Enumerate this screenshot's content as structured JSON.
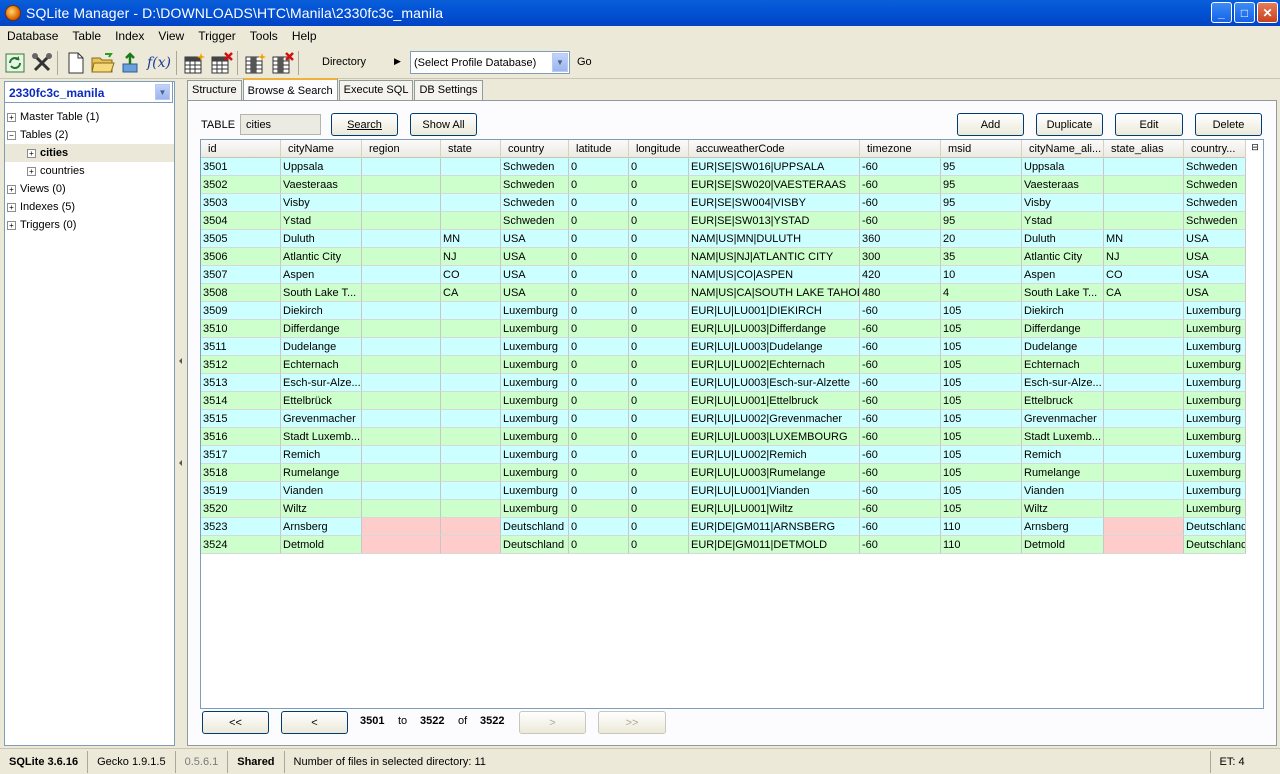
{
  "window": {
    "title": "SQLite Manager - D:\\DOWNLOADS\\HTC\\Manila\\2330fc3c_manila"
  },
  "menu": [
    "Database",
    "Table",
    "Index",
    "View",
    "Trigger",
    "Tools",
    "Help"
  ],
  "toolbar": {
    "directory_label": "Directory",
    "profile_select": "(Select Profile Database)",
    "go_label": "Go",
    "icons": [
      "refresh-icon",
      "tools-icon",
      "new-db-icon",
      "open-db-icon",
      "connect-db-icon",
      "function-icon",
      "create-table-icon",
      "drop-table-icon",
      "create-index-icon",
      "drop-index-icon"
    ],
    "function_glyph": "f(x)"
  },
  "sidebar": {
    "database": "2330fc3c_manila",
    "tree": [
      {
        "label": "Master Table (1)",
        "sign": "+",
        "level": 0,
        "bold": false
      },
      {
        "label": "Tables (2)",
        "sign": "−",
        "level": 0,
        "bold": false
      },
      {
        "label": "cities",
        "sign": "+",
        "level": 1,
        "bold": true
      },
      {
        "label": "countries",
        "sign": "+",
        "level": 1,
        "bold": false
      },
      {
        "label": "Views (0)",
        "sign": "+",
        "level": 0,
        "bold": false
      },
      {
        "label": "Indexes (5)",
        "sign": "+",
        "level": 0,
        "bold": false
      },
      {
        "label": "Triggers (0)",
        "sign": "+",
        "level": 0,
        "bold": false
      }
    ]
  },
  "tabs": [
    "Structure",
    "Browse & Search",
    "Execute SQL",
    "DB Settings"
  ],
  "active_tab": "Browse & Search",
  "browse": {
    "table_label": "TABLE",
    "table_value": "cities",
    "search_label": "Search",
    "showall_label": "Show All",
    "add_label": "Add",
    "duplicate_label": "Duplicate",
    "edit_label": "Edit",
    "delete_label": "Delete"
  },
  "grid": {
    "columns": [
      "id",
      "cityName",
      "region",
      "state",
      "country",
      "latitude",
      "longitude",
      "accuweatherCode",
      "timezone",
      "msid",
      "cityName_ali...",
      "state_alias",
      "country..."
    ],
    "rows": [
      [
        "3501",
        "Uppsala",
        "",
        "",
        "Schweden",
        "0",
        "0",
        "EUR|SE|SW016|UPPSALA",
        "-60",
        "95",
        "Uppsala",
        "",
        "Schweden"
      ],
      [
        "3502",
        "Vaesteraas",
        "",
        "",
        "Schweden",
        "0",
        "0",
        "EUR|SE|SW020|VAESTERAAS",
        "-60",
        "95",
        "Vaesteraas",
        "",
        "Schweden"
      ],
      [
        "3503",
        "Visby",
        "",
        "",
        "Schweden",
        "0",
        "0",
        "EUR|SE|SW004|VISBY",
        "-60",
        "95",
        "Visby",
        "",
        "Schweden"
      ],
      [
        "3504",
        "Ystad",
        "",
        "",
        "Schweden",
        "0",
        "0",
        "EUR|SE|SW013|YSTAD",
        "-60",
        "95",
        "Ystad",
        "",
        "Schweden"
      ],
      [
        "3505",
        "Duluth",
        "",
        "MN",
        "USA",
        "0",
        "0",
        "NAM|US|MN|DULUTH",
        "360",
        "20",
        "Duluth",
        "MN",
        "USA"
      ],
      [
        "3506",
        "Atlantic City",
        "",
        "NJ",
        "USA",
        "0",
        "0",
        "NAM|US|NJ|ATLANTIC CITY",
        "300",
        "35",
        "Atlantic City",
        "NJ",
        "USA"
      ],
      [
        "3507",
        "Aspen",
        "",
        "CO",
        "USA",
        "0",
        "0",
        "NAM|US|CO|ASPEN",
        "420",
        "10",
        "Aspen",
        "CO",
        "USA"
      ],
      [
        "3508",
        "South Lake T...",
        "",
        "CA",
        "USA",
        "0",
        "0",
        "NAM|US|CA|SOUTH LAKE TAHOE",
        "480",
        "4",
        "South Lake T...",
        "CA",
        "USA"
      ],
      [
        "3509",
        "Diekirch",
        "",
        "",
        "Luxemburg",
        "0",
        "0",
        "EUR|LU|LU001|DIEKIRCH",
        "-60",
        "105",
        "Diekirch",
        "",
        "Luxemburg"
      ],
      [
        "3510",
        "Differdange",
        "",
        "",
        "Luxemburg",
        "0",
        "0",
        "EUR|LU|LU003|Differdange",
        "-60",
        "105",
        "Differdange",
        "",
        "Luxemburg"
      ],
      [
        "3511",
        "Dudelange",
        "",
        "",
        "Luxemburg",
        "0",
        "0",
        "EUR|LU|LU003|Dudelange",
        "-60",
        "105",
        "Dudelange",
        "",
        "Luxemburg"
      ],
      [
        "3512",
        "Echternach",
        "",
        "",
        "Luxemburg",
        "0",
        "0",
        "EUR|LU|LU002|Echternach",
        "-60",
        "105",
        "Echternach",
        "",
        "Luxemburg"
      ],
      [
        "3513",
        "Esch-sur-Alze...",
        "",
        "",
        "Luxemburg",
        "0",
        "0",
        "EUR|LU|LU003|Esch-sur-Alzette",
        "-60",
        "105",
        "Esch-sur-Alze...",
        "",
        "Luxemburg"
      ],
      [
        "3514",
        "Ettelbrück",
        "",
        "",
        "Luxemburg",
        "0",
        "0",
        "EUR|LU|LU001|Ettelbruck",
        "-60",
        "105",
        "Ettelbruck",
        "",
        "Luxemburg"
      ],
      [
        "3515",
        "Grevenmacher",
        "",
        "",
        "Luxemburg",
        "0",
        "0",
        "EUR|LU|LU002|Grevenmacher",
        "-60",
        "105",
        "Grevenmacher",
        "",
        "Luxemburg"
      ],
      [
        "3516",
        "Stadt Luxemb...",
        "",
        "",
        "Luxemburg",
        "0",
        "0",
        "EUR|LU|LU003|LUXEMBOURG",
        "-60",
        "105",
        "Stadt Luxemb...",
        "",
        "Luxemburg"
      ],
      [
        "3517",
        "Remich",
        "",
        "",
        "Luxemburg",
        "0",
        "0",
        "EUR|LU|LU002|Remich",
        "-60",
        "105",
        "Remich",
        "",
        "Luxemburg"
      ],
      [
        "3518",
        "Rumelange",
        "",
        "",
        "Luxemburg",
        "0",
        "0",
        "EUR|LU|LU003|Rumelange",
        "-60",
        "105",
        "Rumelange",
        "",
        "Luxemburg"
      ],
      [
        "3519",
        "Vianden",
        "",
        "",
        "Luxemburg",
        "0",
        "0",
        "EUR|LU|LU001|Vianden",
        "-60",
        "105",
        "Vianden",
        "",
        "Luxemburg"
      ],
      [
        "3520",
        "Wiltz",
        "",
        "",
        "Luxemburg",
        "0",
        "0",
        "EUR|LU|LU001|Wiltz",
        "-60",
        "105",
        "Wiltz",
        "",
        "Luxemburg"
      ],
      [
        "3523",
        "Arnsberg",
        "",
        "",
        "Deutschland",
        "0",
        "0",
        "EUR|DE|GM011|ARNSBERG",
        "-60",
        "110",
        "Arnsberg",
        "",
        "Deutschland"
      ],
      [
        "3524",
        "Detmold",
        "",
        "",
        "Deutschland",
        "0",
        "0",
        "EUR|DE|GM011|DETMOLD",
        "-60",
        "110",
        "Detmold",
        "",
        "Deutschland"
      ]
    ],
    "null_cells": [
      [
        20,
        2
      ],
      [
        20,
        3
      ],
      [
        20,
        11
      ],
      [
        21,
        2
      ],
      [
        21,
        3
      ],
      [
        21,
        11
      ]
    ]
  },
  "pager": {
    "first": "<<",
    "prev": "<",
    "next": ">",
    "last": ">>",
    "from": "3501",
    "to_label": "to",
    "to": "3522",
    "of_label": "of",
    "total": "3522"
  },
  "status": {
    "sqlite": "SQLite 3.6.16",
    "gecko": "Gecko 1.9.1.5",
    "version": "0.5.6.1",
    "mode": "Shared",
    "message": "Number of files in selected directory: 11",
    "et": "ET: 4"
  }
}
